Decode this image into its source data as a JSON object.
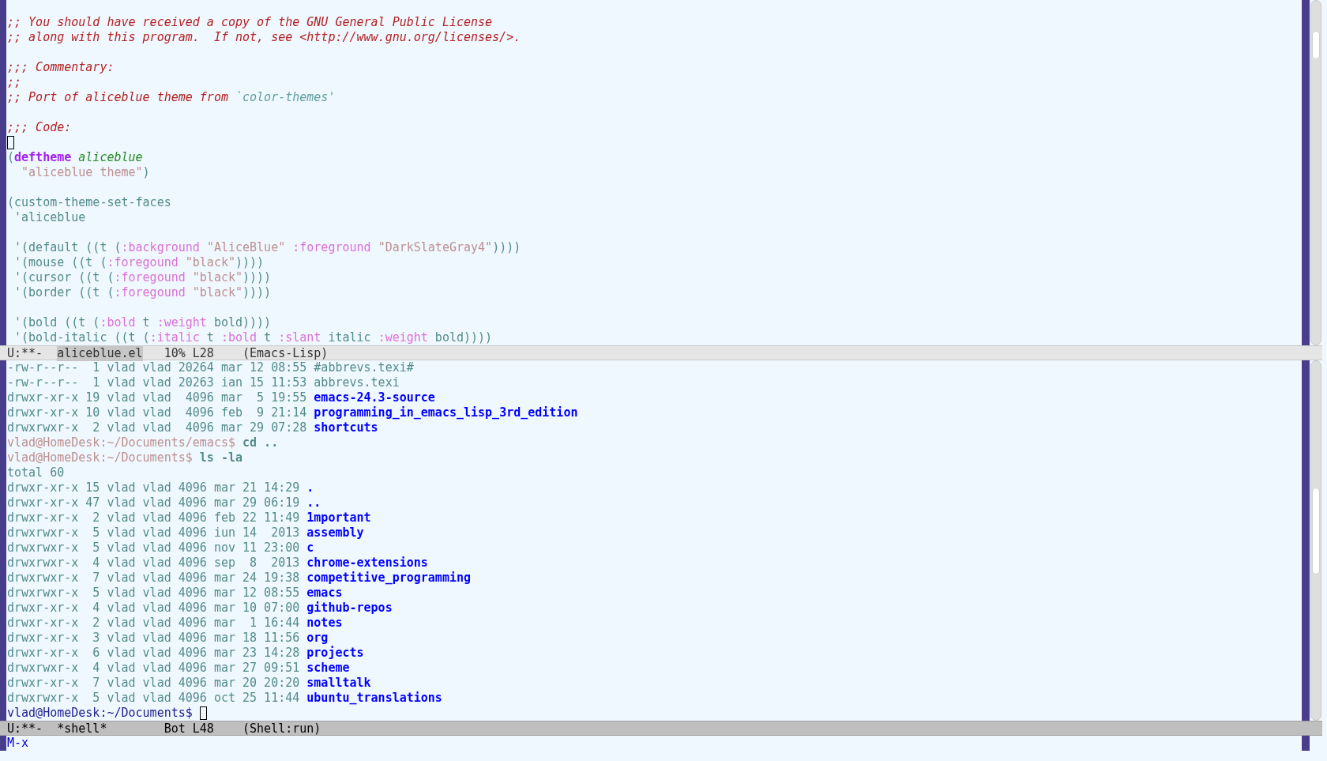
{
  "windows": [
    {
      "kind": "code",
      "lines": [
        {
          "kind": "blank"
        },
        {
          "kind": "text",
          "segments": [
            {
              "kind": "comment",
              "text": ";; You should have received a copy of the GNU General Public License"
            }
          ]
        },
        {
          "kind": "text",
          "segments": [
            {
              "kind": "comment",
              "text": ";; along with this program.  If not, see <http://www.gnu.org/licenses/>."
            }
          ]
        },
        {
          "kind": "blank"
        },
        {
          "kind": "text",
          "segments": [
            {
              "kind": "comment",
              "text": ";;; Commentary:"
            }
          ]
        },
        {
          "kind": "text",
          "segments": [
            {
              "kind": "comment",
              "text": ";;"
            }
          ]
        },
        {
          "kind": "text",
          "segments": [
            {
              "kind": "comment",
              "text": ";; Port of aliceblue theme from "
            },
            {
              "kind": "constant",
              "text": "`color-themes'"
            }
          ]
        },
        {
          "kind": "blank"
        },
        {
          "kind": "text",
          "segments": [
            {
              "kind": "comment",
              "text": ";;; Code:"
            }
          ]
        },
        {
          "kind": "text",
          "segments": [
            {
              "kind": "cursor"
            }
          ]
        },
        {
          "kind": "text",
          "segments": [
            {
              "kind": "plain",
              "text": "("
            },
            {
              "kind": "keyword",
              "text": "deftheme"
            },
            {
              "kind": "function",
              "text": " aliceblue"
            }
          ]
        },
        {
          "kind": "text",
          "segments": [
            {
              "kind": "string",
              "text": "  \"aliceblue theme\""
            },
            {
              "kind": "plain",
              "text": ")"
            }
          ]
        },
        {
          "kind": "blank"
        },
        {
          "kind": "text",
          "segments": [
            {
              "kind": "plain",
              "text": "(custom-theme-set-faces"
            }
          ]
        },
        {
          "kind": "text",
          "segments": [
            {
              "kind": "plain",
              "text": " 'aliceblue"
            }
          ]
        },
        {
          "kind": "blank"
        },
        {
          "kind": "text",
          "segments": [
            {
              "kind": "plain",
              "text": " '(default ((t ("
            },
            {
              "kind": "builtin",
              "text": ":background "
            },
            {
              "kind": "string",
              "text": "\"AliceBlue\" "
            },
            {
              "kind": "builtin",
              "text": ":foreground "
            },
            {
              "kind": "string",
              "text": "\"DarkSlateGray4\""
            },
            {
              "kind": "plain",
              "text": "))))"
            }
          ]
        },
        {
          "kind": "text",
          "segments": [
            {
              "kind": "plain",
              "text": " '(mouse ((t ("
            },
            {
              "kind": "builtin",
              "text": ":foregound "
            },
            {
              "kind": "string",
              "text": "\"black\""
            },
            {
              "kind": "plain",
              "text": "))))"
            }
          ]
        },
        {
          "kind": "text",
          "segments": [
            {
              "kind": "plain",
              "text": " '(cursor ((t ("
            },
            {
              "kind": "builtin",
              "text": ":foregound "
            },
            {
              "kind": "string",
              "text": "\"black\""
            },
            {
              "kind": "plain",
              "text": "))))"
            }
          ]
        },
        {
          "kind": "text",
          "segments": [
            {
              "kind": "plain",
              "text": " '(border ((t ("
            },
            {
              "kind": "builtin",
              "text": ":foregound "
            },
            {
              "kind": "string",
              "text": "\"black\""
            },
            {
              "kind": "plain",
              "text": "))))"
            }
          ]
        },
        {
          "kind": "blank"
        },
        {
          "kind": "text",
          "segments": [
            {
              "kind": "plain",
              "text": " '(bold ((t ("
            },
            {
              "kind": "builtin",
              "text": ":bold"
            },
            {
              "kind": "plain",
              "text": " t "
            },
            {
              "kind": "builtin",
              "text": ":weight"
            },
            {
              "kind": "plain",
              "text": " bold))))"
            }
          ]
        },
        {
          "kind": "text",
          "segments": [
            {
              "kind": "plain",
              "text": " '(bold-italic ((t ("
            },
            {
              "kind": "builtin",
              "text": ":italic"
            },
            {
              "kind": "plain",
              "text": " t "
            },
            {
              "kind": "builtin",
              "text": ":bold"
            },
            {
              "kind": "plain",
              "text": " t "
            },
            {
              "kind": "builtin",
              "text": ":slant"
            },
            {
              "kind": "plain",
              "text": " italic "
            },
            {
              "kind": "builtin",
              "text": ":weight"
            },
            {
              "kind": "plain",
              "text": " bold))))"
            }
          ]
        }
      ],
      "mode_line": {
        "active": false,
        "status": "U:**-",
        "buffer": {
          "text": "aliceblue.el",
          "highlighted": true
        },
        "position": "10% L28",
        "mode": "(Emacs-Lisp)"
      }
    },
    {
      "kind": "shell",
      "lines": [
        {
          "kind": "text",
          "segments": [
            {
              "kind": "plain",
              "text": "-rw-r--r--  1 vlad vlad 20264 mar 12 08:55 #abbrevs.texi#"
            }
          ]
        },
        {
          "kind": "text",
          "segments": [
            {
              "kind": "plain",
              "text": "-rw-r--r--  1 vlad vlad 20263 ian 15 11:53 abbrevs.texi"
            }
          ]
        },
        {
          "kind": "text",
          "segments": [
            {
              "kind": "plain",
              "text": "drwxr-xr-x 19 vlad vlad  4096 mar  5 19:55 "
            },
            {
              "kind": "directory",
              "text": "emacs-24.3-source"
            }
          ]
        },
        {
          "kind": "text",
          "segments": [
            {
              "kind": "plain",
              "text": "drwxr-xr-x 10 vlad vlad  4096 feb  9 21:14 "
            },
            {
              "kind": "directory",
              "text": "programming_in_emacs_lisp_3rd_edition"
            }
          ]
        },
        {
          "kind": "text",
          "segments": [
            {
              "kind": "plain",
              "text": "drwxrwxr-x  2 vlad vlad  4096 mar 29 07:28 "
            },
            {
              "kind": "directory",
              "text": "shortcuts"
            }
          ]
        },
        {
          "kind": "text",
          "segments": [
            {
              "kind": "prompt",
              "text": "vlad@HomeDesk:~/Documents/emacs$ "
            },
            {
              "kind": "command",
              "text": "cd .."
            }
          ]
        },
        {
          "kind": "text",
          "segments": [
            {
              "kind": "prompt",
              "text": "vlad@HomeDesk:~/Documents$ "
            },
            {
              "kind": "command",
              "text": "ls -la"
            }
          ]
        },
        {
          "kind": "text",
          "segments": [
            {
              "kind": "plain",
              "text": "total 60"
            }
          ]
        },
        {
          "kind": "text",
          "segments": [
            {
              "kind": "plain",
              "text": "drwxr-xr-x 15 vlad vlad 4096 mar 21 14:29 "
            },
            {
              "kind": "directory",
              "text": "."
            }
          ]
        },
        {
          "kind": "text",
          "segments": [
            {
              "kind": "plain",
              "text": "drwxr-xr-x 47 vlad vlad 4096 mar 29 06:19 "
            },
            {
              "kind": "directory",
              "text": ".."
            }
          ]
        },
        {
          "kind": "text",
          "segments": [
            {
              "kind": "plain",
              "text": "drwxr-xr-x  2 vlad vlad 4096 feb 22 11:49 "
            },
            {
              "kind": "directory",
              "text": "1mportant"
            }
          ]
        },
        {
          "kind": "text",
          "segments": [
            {
              "kind": "plain",
              "text": "drwxrwxr-x  5 vlad vlad 4096 iun 14  2013 "
            },
            {
              "kind": "directory",
              "text": "assembly"
            }
          ]
        },
        {
          "kind": "text",
          "segments": [
            {
              "kind": "plain",
              "text": "drwxrwxr-x  5 vlad vlad 4096 nov 11 23:00 "
            },
            {
              "kind": "directory",
              "text": "c"
            }
          ]
        },
        {
          "kind": "text",
          "segments": [
            {
              "kind": "plain",
              "text": "drwxrwxr-x  4 vlad vlad 4096 sep  8  2013 "
            },
            {
              "kind": "directory",
              "text": "chrome-extensions"
            }
          ]
        },
        {
          "kind": "text",
          "segments": [
            {
              "kind": "plain",
              "text": "drwxrwxr-x  7 vlad vlad 4096 mar 24 19:38 "
            },
            {
              "kind": "directory",
              "text": "competitive_programming"
            }
          ]
        },
        {
          "kind": "text",
          "segments": [
            {
              "kind": "plain",
              "text": "drwxrwxr-x  5 vlad vlad 4096 mar 12 08:55 "
            },
            {
              "kind": "directory",
              "text": "emacs"
            }
          ]
        },
        {
          "kind": "text",
          "segments": [
            {
              "kind": "plain",
              "text": "drwxr-xr-x  4 vlad vlad 4096 mar 10 07:00 "
            },
            {
              "kind": "directory",
              "text": "github-repos"
            }
          ]
        },
        {
          "kind": "text",
          "segments": [
            {
              "kind": "plain",
              "text": "drwxr-xr-x  2 vlad vlad 4096 mar  1 16:44 "
            },
            {
              "kind": "directory",
              "text": "notes"
            }
          ]
        },
        {
          "kind": "text",
          "segments": [
            {
              "kind": "plain",
              "text": "drwxr-xr-x  3 vlad vlad 4096 mar 18 11:56 "
            },
            {
              "kind": "directory",
              "text": "org"
            }
          ]
        },
        {
          "kind": "text",
          "segments": [
            {
              "kind": "plain",
              "text": "drwxr-xr-x  6 vlad vlad 4096 mar 23 14:28 "
            },
            {
              "kind": "directory",
              "text": "projects"
            }
          ]
        },
        {
          "kind": "text",
          "segments": [
            {
              "kind": "plain",
              "text": "drwxrwxr-x  4 vlad vlad 4096 mar 27 09:51 "
            },
            {
              "kind": "directory",
              "text": "scheme"
            }
          ]
        },
        {
          "kind": "text",
          "segments": [
            {
              "kind": "plain",
              "text": "drwxr-xr-x  7 vlad vlad 4096 mar 20 20:20 "
            },
            {
              "kind": "directory",
              "text": "smalltalk"
            }
          ]
        },
        {
          "kind": "text",
          "segments": [
            {
              "kind": "plain",
              "text": "drwxrwxr-x  5 vlad vlad 4096 oct 25 11:44 "
            },
            {
              "kind": "directory",
              "text": "ubuntu_translations"
            }
          ]
        },
        {
          "kind": "text",
          "segments": [
            {
              "kind": "current-prompt",
              "text": "vlad@HomeDesk:~/Documents$ "
            },
            {
              "kind": "cursor"
            }
          ]
        }
      ],
      "mode_line": {
        "active": true,
        "status": "U:**-",
        "buffer": {
          "text": "*shell*",
          "highlighted": false
        },
        "position": "Bot L48",
        "mode": "(Shell:run)"
      }
    }
  ],
  "minibuffer": {
    "text": "M-x"
  }
}
